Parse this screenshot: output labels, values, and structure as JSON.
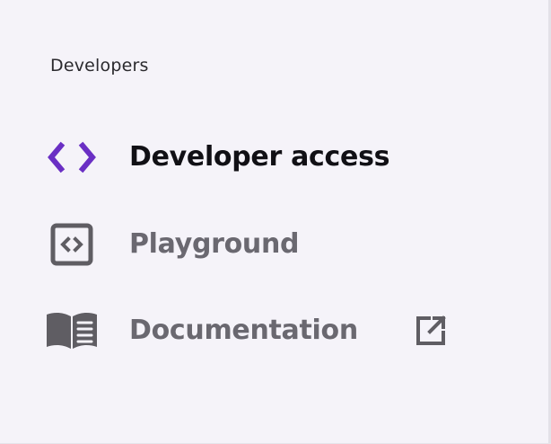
{
  "sidebar": {
    "section_title": "Developers",
    "items": [
      {
        "label": "Developer access",
        "icon": "code-brackets-icon",
        "active": true
      },
      {
        "label": "Playground",
        "icon": "code-window-icon",
        "active": false
      },
      {
        "label": "Documentation",
        "icon": "book-icon",
        "active": false,
        "external_icon": "external-link-icon"
      }
    ]
  },
  "colors": {
    "background": "#f5f3f9",
    "active_accent": "#6a2fc4",
    "active_text": "#111015",
    "inactive_text": "#6a6870",
    "icon_gray": "#5f5d63"
  }
}
